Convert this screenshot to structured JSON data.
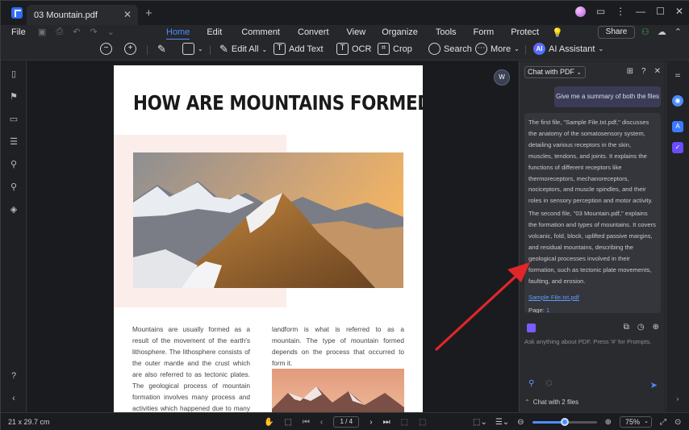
{
  "tab": {
    "title": "03 Mountain.pdf"
  },
  "menubar": {
    "file": "File",
    "items": [
      "Home",
      "Edit",
      "Comment",
      "Convert",
      "View",
      "Organize",
      "Tools",
      "Form",
      "Protect"
    ],
    "active": "Home",
    "share": "Share"
  },
  "toolbar": {
    "edit_all": "Edit All",
    "add_text": "Add Text",
    "ocr": "OCR",
    "crop": "Crop",
    "search": "Search",
    "more": "More",
    "ai_assistant": "AI Assistant",
    "ai_badge": "AI"
  },
  "document": {
    "title": "HOW ARE MOUNTAINS FORMED?",
    "col1": "Mountains are usually formed as a result of the movement of the earth's lithosphere. The lithosphere consists of the outer mantle and the crust which are also referred to as tectonic plates. The geological process of mountain formation involves many process and activities which happened due to many forces acting together or in isolation. The",
    "col2": "landform is what is referred to as a mountain. The type of mountain formed depends on the process that occurred to form it."
  },
  "panel": {
    "mode": "Chat with PDF",
    "user_message": "Give me a summary of both the files",
    "answer_p1": "The first file, \"Sample File.txt.pdf,\" discusses the anatomy of the somatosensory system, detailing various receptors in the skin, muscles, tendons, and joints. It explains the functions of different receptors like thermoreceptors, mechanoreceptors, nociceptors, and muscle spindles, and their roles in sensory perception and motor activity.",
    "answer_p2": "The second file, \"03 Mountain.pdf,\" explains the formation and types of mountains. It covers volcanic, fold, block, uplifted passive margins, and residual mountains, describing the geological processes involved in their formation, such as tectonic plate movements, faulting, and erosion.",
    "source_link": "Sample File.txt.pdf",
    "page_label": "Page:",
    "page_num": "1",
    "prompt_placeholder": "Ask anything about PDF. Press '#' for Prompts.",
    "chat_files": "Chat with 2 files"
  },
  "status": {
    "page_size": "21 x 29.7 cm",
    "page_indicator": "1 / 4",
    "zoom": "75%",
    "zoom_slider_level": 0.5
  },
  "colors": {
    "accent": "#4d8dff",
    "arrow": "#e0262a"
  }
}
